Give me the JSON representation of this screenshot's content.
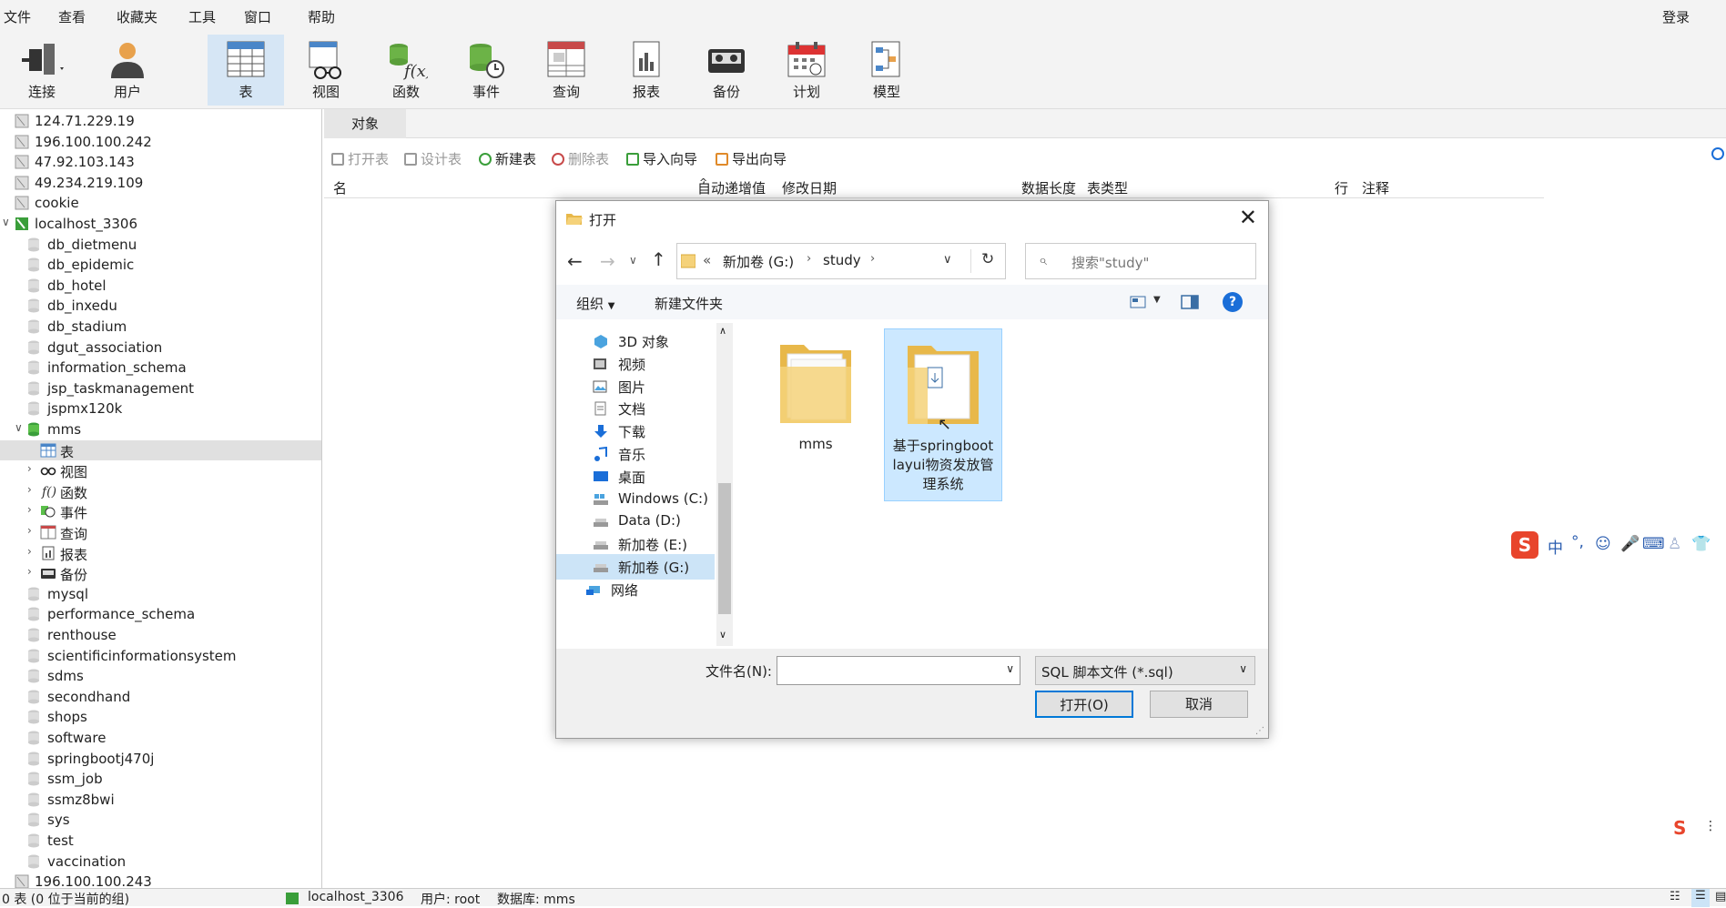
{
  "menu": [
    "文件",
    "查看",
    "收藏夹",
    "工具",
    "窗口",
    "帮助"
  ],
  "login": "登录",
  "toolbar": [
    "连接",
    "用户",
    "表",
    "视图",
    "函数",
    "事件",
    "查询",
    "报表",
    "备份",
    "计划",
    "模型"
  ],
  "tree": [
    {
      "label": "124.71.229.19",
      "level": 0,
      "icon": "server-icon"
    },
    {
      "label": "196.100.100.242",
      "level": 0,
      "icon": "server-icon"
    },
    {
      "label": "47.92.103.143",
      "level": 0,
      "icon": "server-icon"
    },
    {
      "label": "49.234.219.109",
      "level": 0,
      "icon": "server-icon"
    },
    {
      "label": "cookie",
      "level": 0,
      "icon": "server-icon"
    },
    {
      "label": "localhost_3306",
      "level": 0,
      "icon": "server-connected-icon",
      "open": true
    },
    {
      "label": "db_dietmenu",
      "level": 1,
      "icon": "database-icon"
    },
    {
      "label": "db_epidemic",
      "level": 1,
      "icon": "database-icon"
    },
    {
      "label": "db_hotel",
      "level": 1,
      "icon": "database-icon"
    },
    {
      "label": "db_inxedu",
      "level": 1,
      "icon": "database-icon"
    },
    {
      "label": "db_stadium",
      "level": 1,
      "icon": "database-icon"
    },
    {
      "label": "dgut_association",
      "level": 1,
      "icon": "database-icon"
    },
    {
      "label": "information_schema",
      "level": 1,
      "icon": "database-icon"
    },
    {
      "label": "jsp_taskmanagement",
      "level": 1,
      "icon": "database-icon"
    },
    {
      "label": "jspmx120k",
      "level": 1,
      "icon": "database-icon"
    },
    {
      "label": "mms",
      "level": 1,
      "icon": "database-open-icon",
      "open": true
    },
    {
      "label": "表",
      "level": 2,
      "icon": "table-icon",
      "selected": true
    },
    {
      "label": "视图",
      "level": 2,
      "icon": "view-icon",
      "collapsed": true
    },
    {
      "label": "函数",
      "level": 2,
      "icon": "function-icon",
      "collapsed": true
    },
    {
      "label": "事件",
      "level": 2,
      "icon": "event-icon",
      "collapsed": true
    },
    {
      "label": "查询",
      "level": 2,
      "icon": "query-icon",
      "collapsed": true
    },
    {
      "label": "报表",
      "level": 2,
      "icon": "report-icon",
      "collapsed": true
    },
    {
      "label": "备份",
      "level": 2,
      "icon": "backup-icon",
      "collapsed": true
    },
    {
      "label": "mysql",
      "level": 1,
      "icon": "database-icon"
    },
    {
      "label": "performance_schema",
      "level": 1,
      "icon": "database-icon"
    },
    {
      "label": "renthouse",
      "level": 1,
      "icon": "database-icon"
    },
    {
      "label": "scientificinformationsystem",
      "level": 1,
      "icon": "database-icon"
    },
    {
      "label": "sdms",
      "level": 1,
      "icon": "database-icon"
    },
    {
      "label": "secondhand",
      "level": 1,
      "icon": "database-icon"
    },
    {
      "label": "shops",
      "level": 1,
      "icon": "database-icon"
    },
    {
      "label": "software",
      "level": 1,
      "icon": "database-icon"
    },
    {
      "label": "springbootj470j",
      "level": 1,
      "icon": "database-icon"
    },
    {
      "label": "ssm_job",
      "level": 1,
      "icon": "database-icon"
    },
    {
      "label": "ssmz8bwi",
      "level": 1,
      "icon": "database-icon"
    },
    {
      "label": "sys",
      "level": 1,
      "icon": "database-icon"
    },
    {
      "label": "test",
      "level": 1,
      "icon": "database-icon"
    },
    {
      "label": "vaccination",
      "level": 1,
      "icon": "database-icon"
    },
    {
      "label": "196.100.100.243",
      "level": 0,
      "icon": "server-icon"
    }
  ],
  "main": {
    "tab": "对象",
    "actions": [
      {
        "label": "打开表",
        "disabled": true
      },
      {
        "label": "设计表",
        "disabled": true
      },
      {
        "label": "新建表",
        "disabled": false
      },
      {
        "label": "删除表",
        "disabled": true
      },
      {
        "label": "导入向导",
        "disabled": false
      },
      {
        "label": "导出向导",
        "disabled": false
      }
    ],
    "columns": [
      "名",
      "自动递增值",
      "修改日期",
      "数据长度",
      "表类型",
      "行",
      "注释"
    ]
  },
  "dialog": {
    "title": "打开",
    "path": [
      "新加卷 (G:)",
      "study"
    ],
    "path_prefix": "«",
    "search_placeholder": "搜索\"study\"",
    "organize": "组织",
    "new_folder": "新建文件夹",
    "nav": [
      {
        "label": "3D 对象",
        "icon": "3d-objects-icon"
      },
      {
        "label": "视频",
        "icon": "video-icon"
      },
      {
        "label": "图片",
        "icon": "pictures-icon"
      },
      {
        "label": "文档",
        "icon": "documents-icon"
      },
      {
        "label": "下载",
        "icon": "download-icon"
      },
      {
        "label": "音乐",
        "icon": "music-icon"
      },
      {
        "label": "桌面",
        "icon": "desktop-icon"
      },
      {
        "label": "Windows (C:)",
        "icon": "drive-windows-icon"
      },
      {
        "label": "Data (D:)",
        "icon": "drive-icon"
      },
      {
        "label": "新加卷 (E:)",
        "icon": "drive-icon"
      },
      {
        "label": "新加卷 (G:)",
        "icon": "drive-icon",
        "selected": true
      },
      {
        "label": "网络",
        "icon": "network-icon"
      }
    ],
    "files": [
      {
        "name": "mms",
        "selected": false
      },
      {
        "name": "基于springboot layui物资发放管理系统",
        "selected": true
      }
    ],
    "filename_label": "文件名(N):",
    "filename_value": "",
    "filetype": "SQL 脚本文件 (*.sql)",
    "open_button": "打开(O)",
    "cancel_button": "取消"
  },
  "status": {
    "left": "0 表 (0 位于当前的组)",
    "connection": "localhost_3306",
    "user": "用户: root",
    "database": "数据库: mms"
  },
  "colors": {
    "accent": "#0078d7",
    "selection": "#cce8ff",
    "toolbar_bg": "#f3f3f3",
    "ime_red": "#e8452c"
  }
}
